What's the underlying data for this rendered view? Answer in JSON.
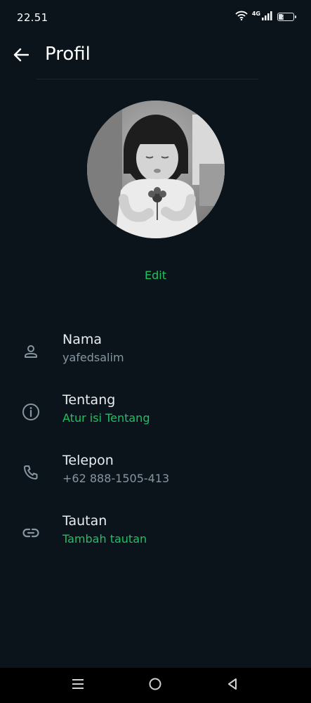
{
  "status_bar": {
    "time": "22.51",
    "network": "4G",
    "battery_level": "32",
    "battery_fraction": 0.32
  },
  "header": {
    "back_icon": "arrow-left-icon",
    "title": "Profil"
  },
  "profile": {
    "avatar_icon": "profile-photo",
    "edit_label": "Edit"
  },
  "rows": [
    {
      "icon": "person-icon",
      "title": "Nama",
      "subtitle": "yafedsalim",
      "accent": false
    },
    {
      "icon": "info-icon",
      "title": "Tentang",
      "subtitle": "Atur isi Tentang",
      "accent": true
    },
    {
      "icon": "phone-icon",
      "title": "Telepon",
      "subtitle": "+62 888-1505-413",
      "accent": false
    },
    {
      "icon": "link-icon",
      "title": "Tautan",
      "subtitle": "Tambah tautan",
      "accent": true
    }
  ],
  "nav_bar": {
    "icons": [
      "menu-icon",
      "home-icon",
      "back-triangle-icon"
    ]
  },
  "colors": {
    "background": "#0b141b",
    "accent": "#21c063",
    "secondary_text": "#8696a0",
    "primary_text": "#e9edef"
  }
}
